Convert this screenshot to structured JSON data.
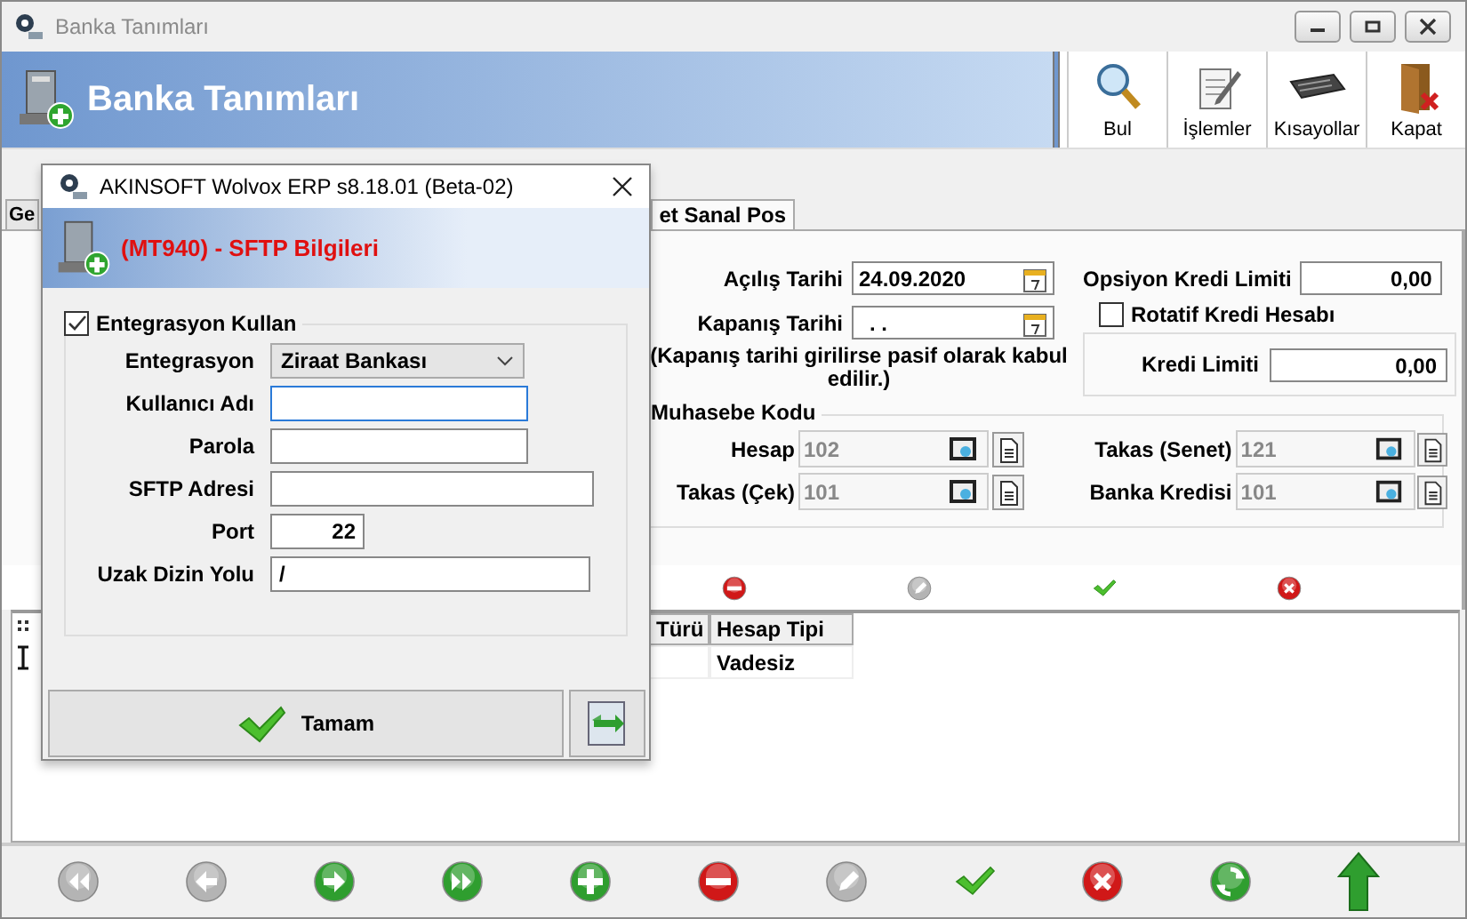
{
  "window": {
    "title": "Banka Tanımları"
  },
  "header": {
    "title": "Banka Tanımları"
  },
  "toolbar": [
    {
      "kind": "search",
      "label": "Bul"
    },
    {
      "kind": "operations",
      "label": "İşlemler"
    },
    {
      "kind": "keyboard",
      "label": "Kısayollar"
    },
    {
      "kind": "exit",
      "label": "Kapat"
    }
  ],
  "tabs": [
    {
      "label": "Ge",
      "selected": false
    },
    {
      "label": "et Sanal Pos",
      "selected": true
    }
  ],
  "form": {
    "opening_date": {
      "label": "Açılış Tarihi",
      "value": "24.09.2020"
    },
    "closing_date": {
      "label": "Kapanış Tarihi",
      "value": ". ."
    },
    "note": "(Kapanış tarihi girilirse pasif olarak kabul edilir.)",
    "option_credit_limit": {
      "label": "Opsiyon Kredi Limiti",
      "value": "0,00"
    },
    "revolving_credit": {
      "label": "Rotatif Kredi Hesabı",
      "checked": false
    },
    "credit_limit": {
      "label": "Kredi Limiti",
      "value": "0,00"
    },
    "accounting": {
      "title": "Muhasebe Kodu",
      "fields": [
        {
          "label": "Hesap",
          "value": "102"
        },
        {
          "label": "Takas (Senet)",
          "value": "121"
        },
        {
          "label": "Takas (Çek)",
          "value": "101"
        },
        {
          "label": "Banka Kredisi",
          "value": "101"
        }
      ]
    }
  },
  "record_toolbar": [
    {
      "kind": "delete",
      "disabled": false
    },
    {
      "kind": "edit",
      "disabled": true
    },
    {
      "kind": "confirm",
      "disabled": false
    },
    {
      "kind": "cancel",
      "disabled": false
    }
  ],
  "grid": {
    "columns": [
      "Türü",
      "Hesap Tipi"
    ],
    "rows": [
      [
        "",
        "Vadesiz"
      ]
    ]
  },
  "nav_bar": [
    {
      "kind": "first",
      "disabled": true
    },
    {
      "kind": "previous",
      "disabled": true
    },
    {
      "kind": "next",
      "disabled": false
    },
    {
      "kind": "last",
      "disabled": false
    },
    {
      "kind": "add",
      "disabled": false
    },
    {
      "kind": "delete",
      "disabled": false
    },
    {
      "kind": "edit",
      "disabled": true
    },
    {
      "kind": "confirm",
      "disabled": false
    },
    {
      "kind": "cancel",
      "disabled": false
    },
    {
      "kind": "refresh",
      "disabled": false
    },
    {
      "kind": "up",
      "disabled": false
    }
  ],
  "dialog": {
    "title": "AKINSOFT Wolvox ERP s8.18.01 (Beta-02)",
    "heading": "(MT940) - SFTP Bilgileri",
    "use_integration": {
      "label": "Entegrasyon Kullan",
      "checked": true
    },
    "fields": [
      {
        "kind": "select",
        "label": "Entegrasyon",
        "value": "Ziraat Bankası"
      },
      {
        "kind": "text",
        "label": "Kullanıcı Adı",
        "focused": true
      },
      {
        "kind": "text",
        "label": "Parola",
        "focused": false
      },
      {
        "kind": "text",
        "label": "SFTP Adresi",
        "focused": false
      },
      {
        "kind": "number",
        "label": "Port",
        "value": "22",
        "focused": false
      },
      {
        "kind": "text",
        "label": "Uzak Dizin Yolu",
        "value": "/",
        "focused": false
      }
    ],
    "ok_button": "Tamam"
  }
}
